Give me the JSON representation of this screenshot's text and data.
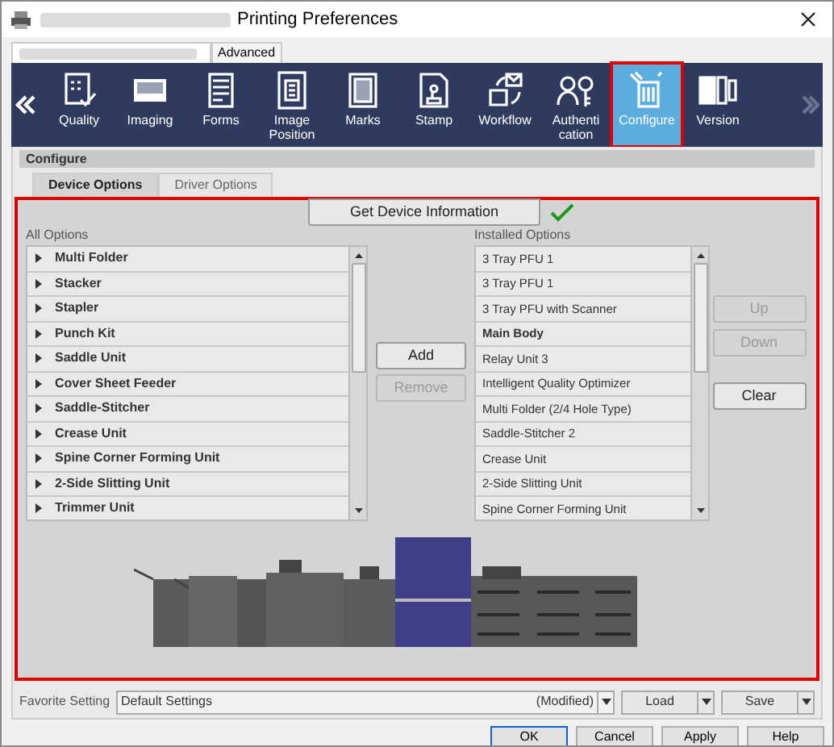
{
  "window": {
    "title": "Printing Preferences"
  },
  "tabs": [
    {
      "label": "Advanced",
      "selected": false
    }
  ],
  "nav": {
    "items": [
      {
        "label": "Quality",
        "kind": "quality",
        "selected": false
      },
      {
        "label": "Imaging",
        "kind": "imaging",
        "selected": false
      },
      {
        "label": "Forms",
        "kind": "forms",
        "selected": false
      },
      {
        "label": "Image\nPosition",
        "kind": "position",
        "selected": false
      },
      {
        "label": "Marks",
        "kind": "marks",
        "selected": false
      },
      {
        "label": "Stamp",
        "kind": "stamp",
        "selected": false
      },
      {
        "label": "Workflow",
        "kind": "workflow",
        "selected": false
      },
      {
        "label": "Authenti\ncation",
        "kind": "auth",
        "selected": false
      },
      {
        "label": "Configure",
        "kind": "configure",
        "selected": true
      },
      {
        "label": "Version",
        "kind": "version",
        "selected": false
      }
    ]
  },
  "section": {
    "title": "Configure"
  },
  "subtabs": [
    {
      "label": "Device Options",
      "selected": true
    },
    {
      "label": "Driver Options",
      "selected": false
    }
  ],
  "device_options": {
    "get_info_button": "Get Device Information",
    "all_options": {
      "label": "All Options",
      "items": [
        {
          "label": "Multi Folder",
          "expanded": false
        },
        {
          "label": "Stacker",
          "expanded": false
        },
        {
          "label": "Stapler",
          "expanded": false
        },
        {
          "label": "Punch Kit",
          "expanded": false
        },
        {
          "label": "Saddle Unit",
          "expanded": false
        },
        {
          "label": "Cover Sheet Feeder",
          "expanded": false
        },
        {
          "label": "Saddle-Stitcher",
          "expanded": false
        },
        {
          "label": "Crease Unit",
          "expanded": false
        },
        {
          "label": "Spine Corner Forming Unit",
          "expanded": false
        },
        {
          "label": "2-Side Slitting Unit",
          "expanded": false
        },
        {
          "label": "Trimmer Unit",
          "expanded": false
        }
      ]
    },
    "middle_buttons": [
      {
        "label": "Add",
        "disabled": false
      },
      {
        "label": "Remove",
        "disabled": true
      }
    ],
    "installed_options": {
      "label": "Installed Options",
      "items": [
        {
          "label": "3 Tray PFU 1",
          "bold": false
        },
        {
          "label": "3 Tray PFU 1",
          "bold": false
        },
        {
          "label": "3 Tray PFU with Scanner",
          "bold": false
        },
        {
          "label": "Main Body",
          "bold": true
        },
        {
          "label": "Relay Unit 3",
          "bold": false
        },
        {
          "label": "Intelligent Quality Optimizer",
          "bold": false
        },
        {
          "label": "Multi Folder (2/4 Hole Type)",
          "bold": false
        },
        {
          "label": "Saddle-Stitcher 2",
          "bold": false
        },
        {
          "label": "Crease Unit",
          "bold": false
        },
        {
          "label": "2-Side Slitting Unit",
          "bold": false
        },
        {
          "label": "Spine Corner Forming Unit",
          "bold": false
        }
      ]
    },
    "side_buttons": [
      {
        "label": "Up",
        "disabled": true
      },
      {
        "label": "Down",
        "disabled": true
      },
      {
        "label": "Clear",
        "disabled": false
      }
    ]
  },
  "favorite": {
    "label": "Favorite Setting",
    "value": "Default Settings",
    "status": "(Modified)",
    "load": "Load",
    "save": "Save"
  },
  "buttons": [
    {
      "label": "OK",
      "default": true
    },
    {
      "label": "Cancel",
      "default": false
    },
    {
      "label": "Apply",
      "default": false
    },
    {
      "label": "Help",
      "default": false
    }
  ]
}
